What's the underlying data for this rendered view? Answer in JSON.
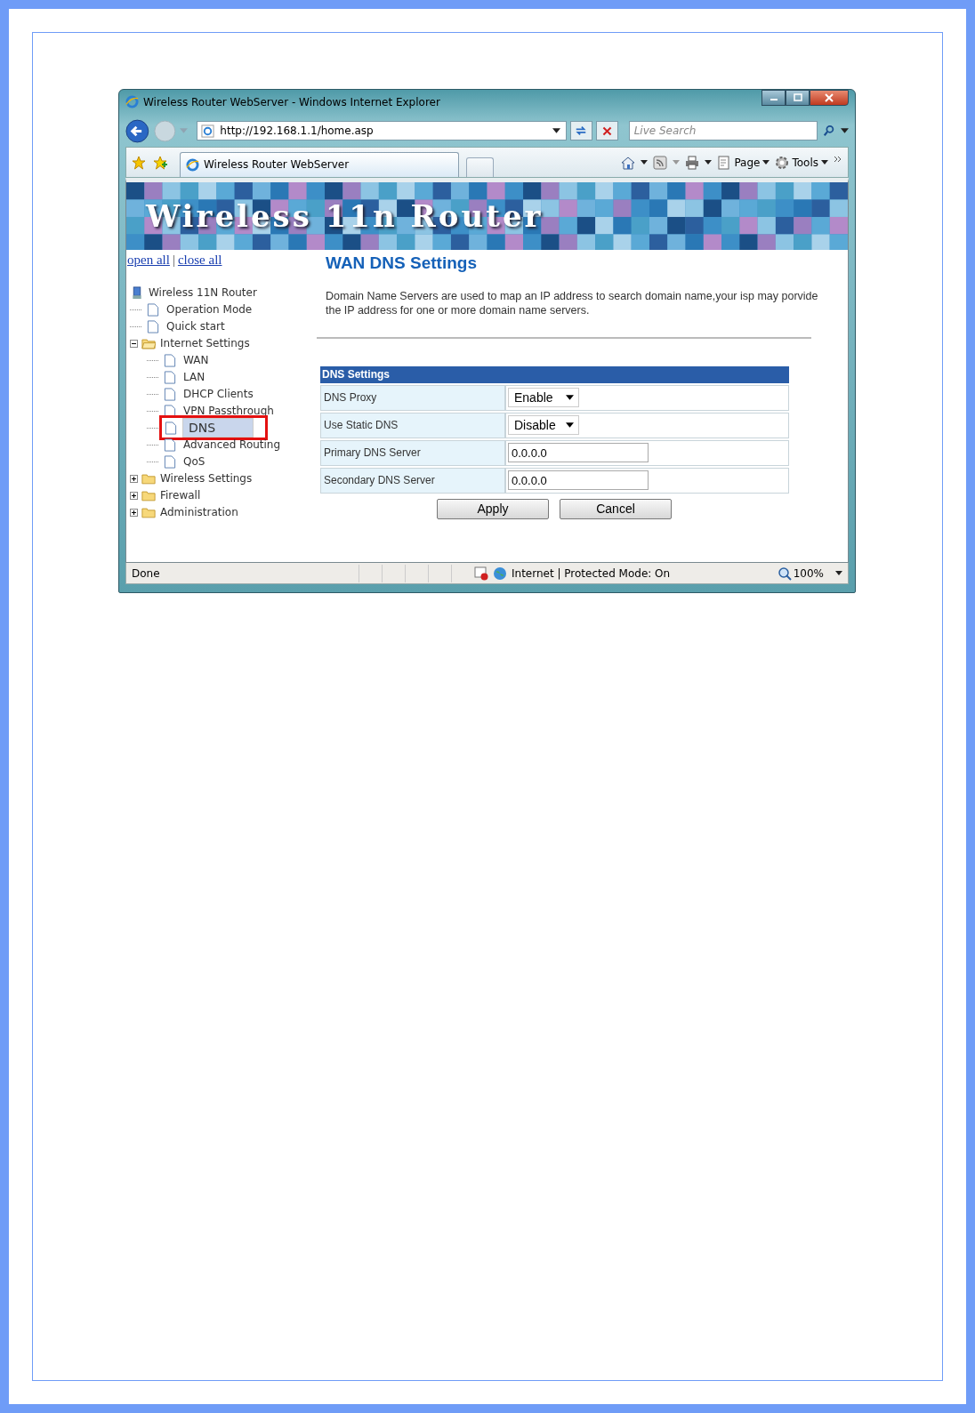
{
  "browser": {
    "title": "Wireless Router WebServer - Windows Internet Explorer",
    "address": "http://192.168.1.1/home.asp",
    "search_placeholder": "Live Search",
    "tab": "Wireless Router WebServer",
    "commands": [
      "Page",
      "Tools"
    ]
  },
  "banner": {
    "title": "Wireless 11n Router"
  },
  "links": [
    "open all",
    "|",
    "close all"
  ],
  "tree": {
    "label": "Wireless 11N Router",
    "children": [
      {
        "label": "Operation Mode",
        "kind": "page",
        "selected": false
      },
      {
        "label": "Quick start",
        "kind": "page",
        "selected": false
      },
      {
        "label": "Internet Settings",
        "kind": "folder",
        "expanded": true,
        "children": [
          {
            "label": "WAN",
            "kind": "page",
            "selected": false
          },
          {
            "label": "LAN",
            "kind": "page",
            "selected": false
          },
          {
            "label": "DHCP Clients",
            "kind": "page",
            "selected": false
          },
          {
            "label": "VPN Passthrough",
            "kind": "page",
            "selected": false
          },
          {
            "label": "DNS",
            "kind": "page",
            "selected": true
          },
          {
            "label": "Advanced Routing",
            "kind": "page",
            "selected": false
          },
          {
            "label": "QoS",
            "kind": "page",
            "selected": false
          }
        ]
      },
      {
        "label": "Wireless Settings",
        "kind": "folder",
        "expanded": false
      },
      {
        "label": "Firewall",
        "kind": "folder",
        "expanded": false
      },
      {
        "label": "Administration",
        "kind": "folder",
        "expanded": false
      }
    ]
  },
  "heading": "WAN DNS Settings",
  "description": "Domain Name Servers are used to map an IP address to search domain name,your isp may porvide the IP address for one or more domain name servers.",
  "section_title": "DNS Settings",
  "rows": [
    {
      "label": "DNS Proxy",
      "kind": "select",
      "value": "Enable"
    },
    {
      "label": "Use Static DNS",
      "kind": "select",
      "value": "Disable"
    },
    {
      "label": "Primary DNS Server",
      "kind": "text",
      "value": "0.0.0.0"
    },
    {
      "label": "Secondary DNS Server",
      "kind": "text",
      "value": "0.0.0.0"
    }
  ],
  "buttons": [
    "Apply",
    "Cancel"
  ],
  "status": {
    "text": "Done",
    "zone": "Internet | Protected Mode: On",
    "zoom": "100%"
  }
}
